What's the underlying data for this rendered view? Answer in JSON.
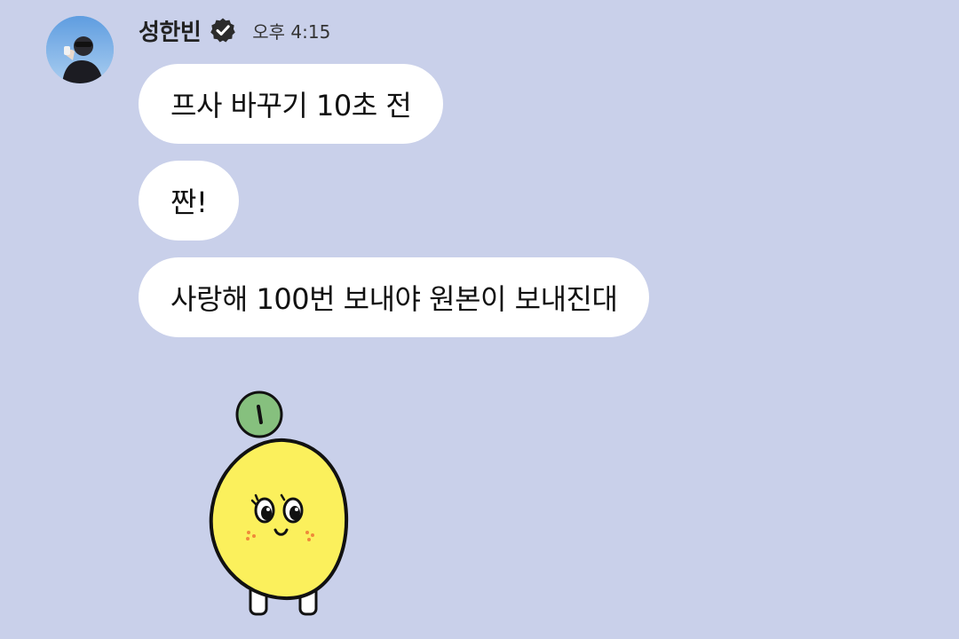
{
  "sender": {
    "name": "성한빈",
    "verified": true,
    "timestamp": "오후 4:15",
    "avatar_icon": "profile-photo"
  },
  "messages": [
    {
      "text": "프사 바꾸기 10초 전"
    },
    {
      "text": "짠!"
    },
    {
      "text": "사랑해 100번 보내야 원본이 보내진대"
    }
  ],
  "sticker": {
    "icon": "lemon-character-sticker"
  },
  "colors": {
    "background": "#c9d0ea",
    "bubble": "#ffffff",
    "lemon": "#fbf05c",
    "leaf": "#86c07e"
  }
}
